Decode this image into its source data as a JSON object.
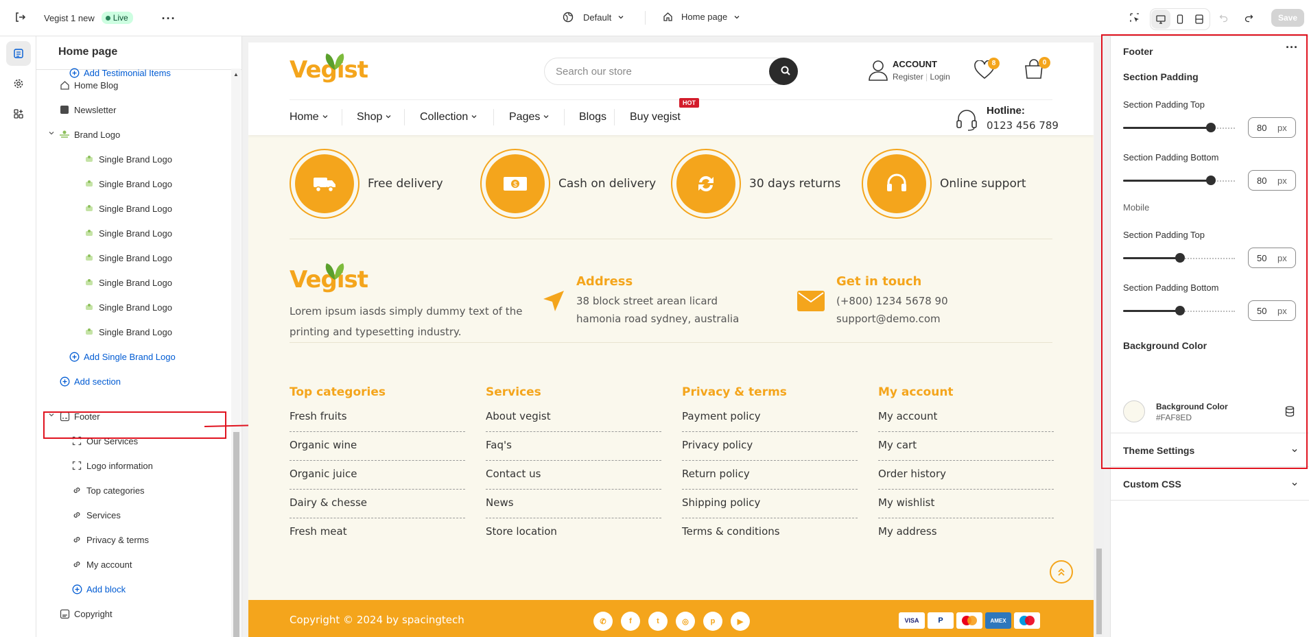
{
  "topbar": {
    "store_name": "Vegist 1 new",
    "live_label": "Live",
    "theme_select": "Default",
    "page_select": "Home page",
    "save_label": "Save"
  },
  "tree": {
    "title": "Home page",
    "items": [
      {
        "label": "Add Testimonial Items",
        "type": "link",
        "icon": "plus-circle-icon"
      },
      {
        "label": "Home Blog",
        "type": "section",
        "icon": "home-icon"
      },
      {
        "label": "Newsletter",
        "type": "section",
        "icon": "newsletter-icon"
      },
      {
        "label": "Brand Logo",
        "type": "section",
        "icon": "brand-logo-icon"
      },
      {
        "label": "Single Brand Logo",
        "type": "block",
        "icon": "brand-thumb-icon"
      },
      {
        "label": "Single Brand Logo",
        "type": "block",
        "icon": "brand-thumb-icon"
      },
      {
        "label": "Single Brand Logo",
        "type": "block",
        "icon": "brand-thumb-icon"
      },
      {
        "label": "Single Brand Logo",
        "type": "block",
        "icon": "brand-thumb-icon"
      },
      {
        "label": "Single Brand Logo",
        "type": "block",
        "icon": "brand-thumb-icon"
      },
      {
        "label": "Single Brand Logo",
        "type": "block",
        "icon": "brand-thumb-icon"
      },
      {
        "label": "Single Brand Logo",
        "type": "block",
        "icon": "brand-thumb-icon"
      },
      {
        "label": "Single Brand Logo",
        "type": "block",
        "icon": "brand-thumb-icon"
      },
      {
        "label": "Add Single Brand Logo",
        "type": "link",
        "icon": "plus-circle-icon"
      },
      {
        "label": "Add section",
        "type": "link",
        "icon": "plus-circle-icon"
      },
      {
        "label": "Footer",
        "type": "section",
        "icon": "footer-icon"
      },
      {
        "label": "Our Services",
        "type": "block",
        "icon": "block-frame-icon"
      },
      {
        "label": "Logo information",
        "type": "block",
        "icon": "block-frame-icon"
      },
      {
        "label": "Top categories",
        "type": "block",
        "icon": "link-icon"
      },
      {
        "label": "Services",
        "type": "block",
        "icon": "link-icon"
      },
      {
        "label": "Privacy & terms",
        "type": "block",
        "icon": "link-icon"
      },
      {
        "label": "My account",
        "type": "block",
        "icon": "link-icon"
      },
      {
        "label": "Add block",
        "type": "link",
        "icon": "plus-circle-icon"
      },
      {
        "label": "Copyright",
        "type": "section",
        "icon": "copyright-icon"
      }
    ]
  },
  "preview": {
    "logo": "Vegist",
    "search_placeholder": "Search our store",
    "account_title": "ACCOUNT",
    "register": "Register",
    "login": "Login",
    "wishlist_count": "8",
    "cart_count": "0",
    "nav": [
      "Home",
      "Shop",
      "Collection",
      "Pages",
      "Blogs",
      "Buy vegist"
    ],
    "hot_badge": "HOT",
    "hotline_label": "Hotline:",
    "hotline_number": "0123 456 789",
    "features": [
      "Free delivery",
      "Cash on delivery",
      "30 days returns",
      "Online support"
    ],
    "about_text_1": "Lorem ipsum iasds simply dummy text of the",
    "about_text_2": "printing and typesetting industry.",
    "address_title": "Address",
    "address_line1": "38 block street arean licard",
    "address_line2": "hamonia road sydney, australia",
    "contact_title": "Get in touch",
    "contact_phone": "(+800) 1234 5678 90",
    "contact_email": "support@demo.com",
    "columns": [
      {
        "title": "Top categories",
        "items": [
          "Fresh fruits",
          "Organic wine",
          "Organic juice",
          "Dairy & chesse",
          "Fresh meat"
        ]
      },
      {
        "title": "Services",
        "items": [
          "About vegist",
          "Faq's",
          "Contact us",
          "News",
          "Store location"
        ]
      },
      {
        "title": "Privacy & terms",
        "items": [
          "Payment policy",
          "Privacy policy",
          "Return policy",
          "Shipping policy",
          "Terms & conditions"
        ]
      },
      {
        "title": "My account",
        "items": [
          "My account",
          "My cart",
          "Order history",
          "My wishlist",
          "My address"
        ]
      }
    ],
    "copyright": "Copyright © 2024 by spacingtech",
    "payments": [
      "VISA",
      "PayPal",
      "Mastercard",
      "AMEX",
      "Maestro"
    ],
    "accent_color": "#F4A51C"
  },
  "settings": {
    "title": "Footer",
    "section_padding": "Section Padding",
    "padding_top_label": "Section Padding Top",
    "padding_top_value": "80",
    "padding_bottom_label": "Section Padding Bottom",
    "padding_bottom_value": "80",
    "mobile_label": "Mobile",
    "mobile_top_label": "Section Padding Top",
    "mobile_top_value": "50",
    "mobile_bottom_label": "Section Padding Bottom",
    "mobile_bottom_value": "50",
    "unit": "px",
    "bg_heading": "Background Color",
    "bg_label": "Background Color",
    "bg_value": "#FAF8ED",
    "theme_settings": "Theme Settings",
    "custom_css": "Custom CSS"
  }
}
